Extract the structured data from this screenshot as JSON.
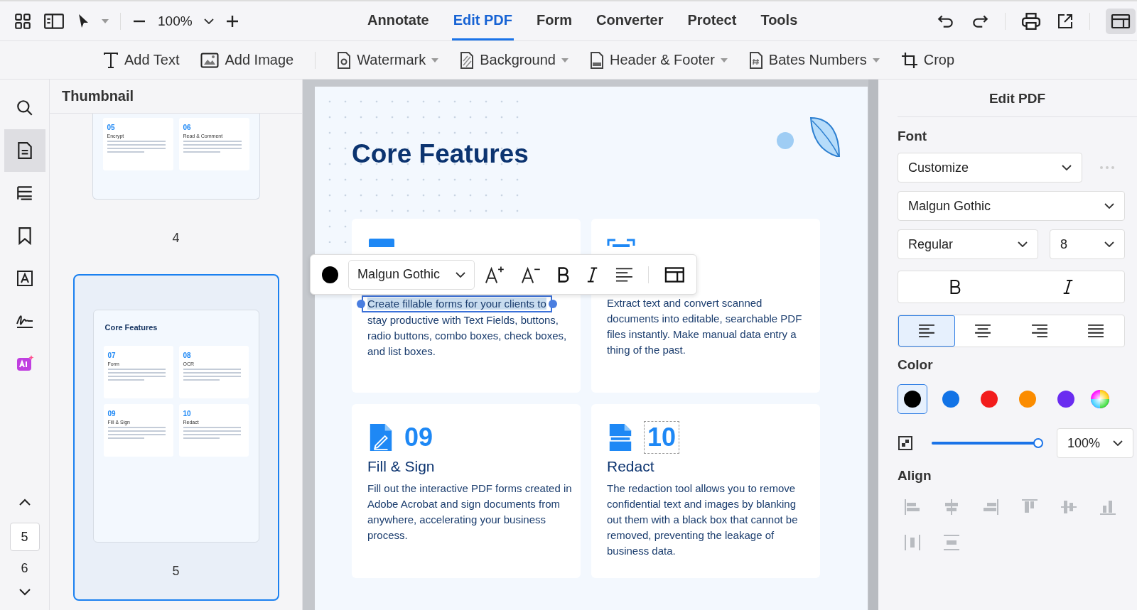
{
  "toolbar": {
    "zoom": "100%"
  },
  "tabs": [
    {
      "label": "Annotate",
      "selected": false
    },
    {
      "label": "Edit PDF",
      "selected": true
    },
    {
      "label": "Form",
      "selected": false
    },
    {
      "label": "Converter",
      "selected": false
    },
    {
      "label": "Protect",
      "selected": false
    },
    {
      "label": "Tools",
      "selected": false
    }
  ],
  "edit_tools": [
    {
      "kind": "text",
      "label": "Add Text",
      "dropdown": false
    },
    {
      "kind": "image",
      "label": "Add Image",
      "dropdown": false
    },
    {
      "kind": "watermark",
      "label": "Watermark",
      "dropdown": true
    },
    {
      "kind": "background",
      "label": "Background",
      "dropdown": true
    },
    {
      "kind": "header",
      "label": "Header & Footer",
      "dropdown": true
    },
    {
      "kind": "bates",
      "label": "Bates Numbers",
      "dropdown": true
    },
    {
      "kind": "crop",
      "label": "Crop",
      "dropdown": false
    }
  ],
  "rail": [
    {
      "kind": "search",
      "selected": false
    },
    {
      "kind": "page",
      "selected": true
    },
    {
      "kind": "outline",
      "selected": false
    },
    {
      "kind": "bookmark",
      "selected": false
    },
    {
      "kind": "textbox",
      "selected": false
    },
    {
      "kind": "signature",
      "selected": false
    },
    {
      "kind": "ai",
      "selected": false
    }
  ],
  "page_nav": {
    "current": "5",
    "next": "6"
  },
  "thumbnails": {
    "title": "Thumbnail",
    "pages": [
      {
        "label": "4",
        "selected": false,
        "cards": [
          {
            "number": "05",
            "title": "Encrypt"
          },
          {
            "number": "06",
            "title": "Read & Comment"
          }
        ]
      },
      {
        "label": "5",
        "selected": true,
        "heading": "Core Features",
        "cards": [
          {
            "number": "07",
            "title": "Form"
          },
          {
            "number": "08",
            "title": "OCR"
          },
          {
            "number": "09",
            "title": "Fill & Sign"
          },
          {
            "number": "10",
            "title": "Redact"
          }
        ]
      }
    ]
  },
  "page": {
    "title": "Core Features",
    "cards": [
      {
        "kind": "form",
        "selection": "Create fillable forms for your clients to",
        "body": "stay productive with Text Fields, buttons, radio buttons, combo boxes, check boxes, and list boxes."
      },
      {
        "kind": "ocr",
        "body": "Extract text and convert scanned documents into editable, searchable PDF files instantly. Make manual data entry a thing of the past."
      },
      {
        "kind": "sign",
        "number": "09",
        "title": "Fill & Sign",
        "body": "Fill out the interactive PDF forms created in Adobe Acrobat and sign documents from anywhere, accelerating your business process."
      },
      {
        "kind": "redact",
        "number": "10",
        "title": "Redact",
        "body": "The redaction tool allows you to remove confidential text and images by blanking out them with a black box that cannot be removed, preventing the leakage of business data."
      }
    ]
  },
  "float_toolbar": {
    "color": "#000000",
    "font": "Malgun Gothic"
  },
  "panel": {
    "title": "Edit PDF",
    "font_label": "Font",
    "preset": "Customize",
    "font": "Malgun Gothic",
    "style": "Regular",
    "size": "8",
    "bold_selected": false,
    "italic_selected": false,
    "align": [
      {
        "kind": "left",
        "selected": true
      },
      {
        "kind": "center",
        "selected": false
      },
      {
        "kind": "right",
        "selected": false
      },
      {
        "kind": "justify",
        "selected": false
      }
    ],
    "color_label": "Color",
    "colors": [
      {
        "color": "#000000",
        "selected": true
      },
      {
        "color": "#1273e6",
        "selected": false
      },
      {
        "color": "#f21c1c",
        "selected": false
      },
      {
        "color": "#fb8c00",
        "selected": false
      },
      {
        "color": "#6a2cf0",
        "selected": false
      }
    ],
    "opacity": {
      "level": 1,
      "reading": "100%"
    },
    "align_label": "Align",
    "align_tools": [
      {
        "kind": "left",
        "disabled": true
      },
      {
        "kind": "hcenter",
        "disabled": true
      },
      {
        "kind": "right",
        "disabled": true
      },
      {
        "kind": "top",
        "disabled": true
      },
      {
        "kind": "vcenter",
        "disabled": true
      },
      {
        "kind": "bottom",
        "disabled": true
      },
      {
        "kind": "hdist",
        "disabled": true
      },
      {
        "kind": "vdist",
        "disabled": true
      }
    ]
  }
}
